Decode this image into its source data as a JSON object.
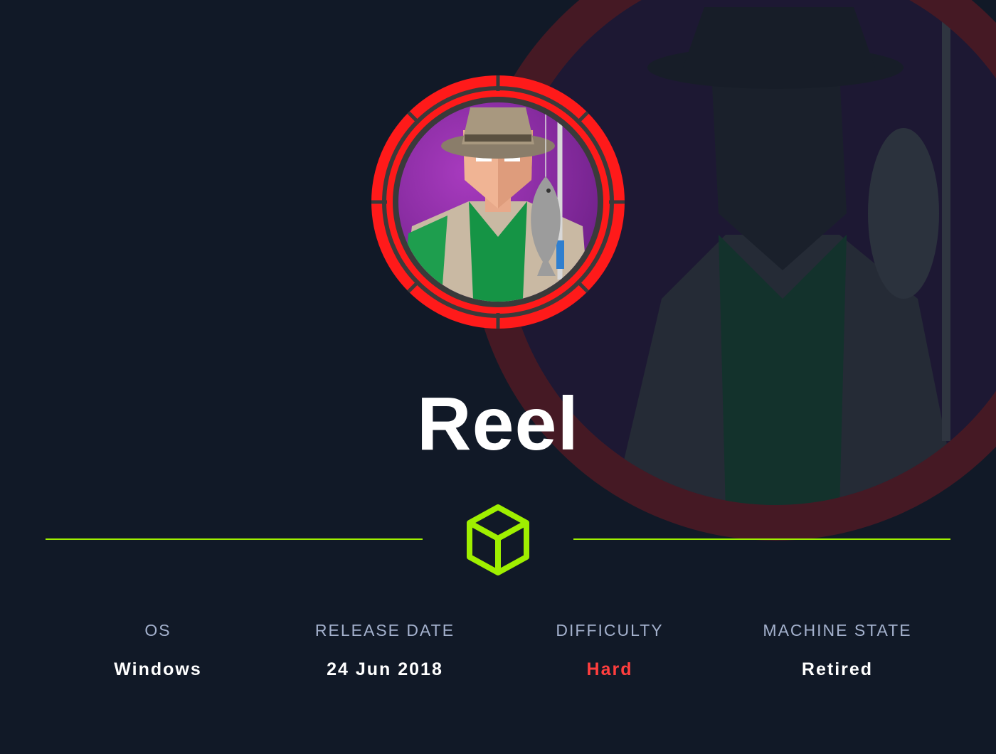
{
  "machine": {
    "name": "Reel"
  },
  "stats": {
    "os": {
      "label": "OS",
      "value": "Windows"
    },
    "release_date": {
      "label": "RELEASE DATE",
      "value": "24 Jun 2018"
    },
    "difficulty": {
      "label": "DIFFICULTY",
      "value": "Hard"
    },
    "machine_state": {
      "label": "MACHINE STATE",
      "value": "Retired"
    }
  },
  "colors": {
    "background": "#111927",
    "accent_green": "#9fef00",
    "difficulty_red": "#ff3e3e",
    "label_gray": "#a4b1cd",
    "avatar_ring": "#ff1a1a",
    "avatar_fill": "#8b2a9c"
  },
  "icons": {
    "avatar": "fisherman-avatar-icon",
    "logo": "hackthebox-cube-icon"
  }
}
